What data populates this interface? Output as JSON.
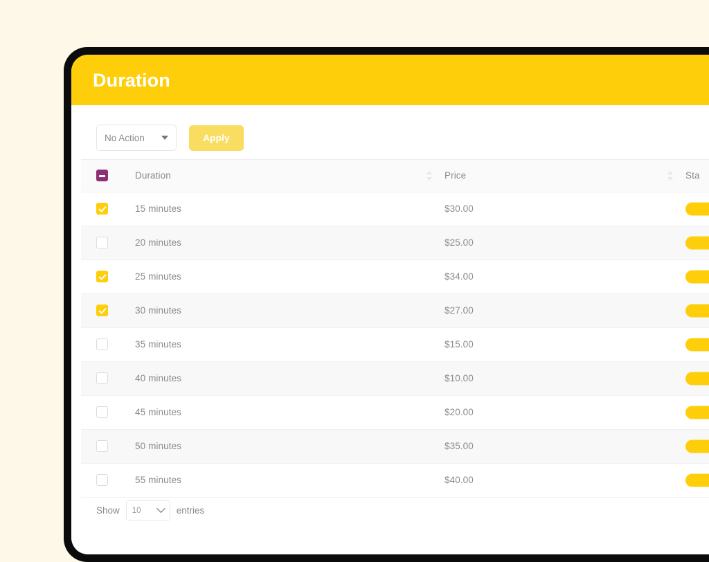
{
  "page": {
    "title": "Duration",
    "header_color": "#FFCE0A",
    "background_color": "#FDF8E7"
  },
  "toolbar": {
    "action_select_value": "No Action",
    "apply_label": "Apply",
    "caret_icon": "chevron-down-icon"
  },
  "table": {
    "select_all_state": "indeterminate",
    "columns": [
      {
        "key": "duration",
        "label": "Duration",
        "sortable": true
      },
      {
        "key": "price",
        "label": "Price",
        "sortable": true
      },
      {
        "key": "status",
        "label": "Sta",
        "sortable": true
      }
    ],
    "rows": [
      {
        "checked": true,
        "duration": "15 minutes",
        "price": "$30.00",
        "status_color": "#FFCE0A"
      },
      {
        "checked": false,
        "duration": "20 minutes",
        "price": "$25.00",
        "status_color": "#FFCE0A"
      },
      {
        "checked": true,
        "duration": "25 minutes",
        "price": "$34.00",
        "status_color": "#FFCE0A"
      },
      {
        "checked": true,
        "duration": "30 minutes",
        "price": "$27.00",
        "status_color": "#FFCE0A"
      },
      {
        "checked": false,
        "duration": "35 minutes",
        "price": "$15.00",
        "status_color": "#FFCE0A"
      },
      {
        "checked": false,
        "duration": "40 minutes",
        "price": "$10.00",
        "status_color": "#FFCE0A"
      },
      {
        "checked": false,
        "duration": "45 minutes",
        "price": "$20.00",
        "status_color": "#FFCE0A"
      },
      {
        "checked": false,
        "duration": "50 minutes",
        "price": "$35.00",
        "status_color": "#FFCE0A"
      },
      {
        "checked": false,
        "duration": "55 minutes",
        "price": "$40.00",
        "status_color": "#FFCE0A"
      }
    ]
  },
  "footer": {
    "show_label": "Show",
    "entries_value": "10",
    "entries_label": "entries",
    "chevron_icon": "chevron-down-icon"
  }
}
